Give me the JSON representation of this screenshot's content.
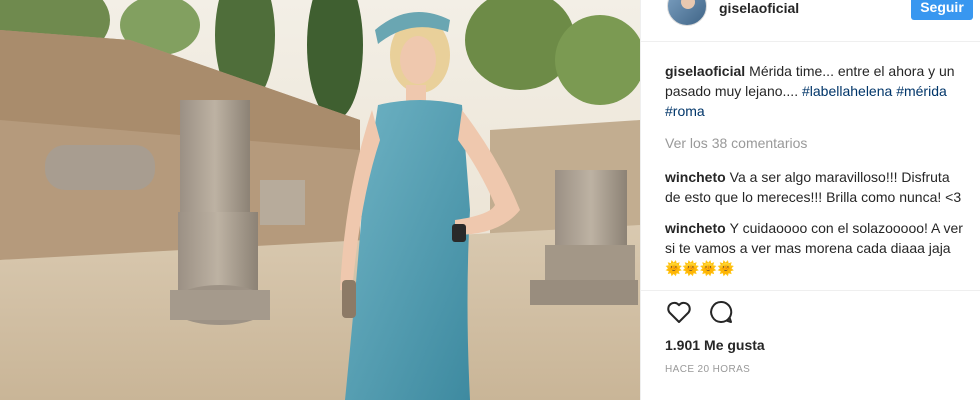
{
  "post": {
    "username": "giselaoficial",
    "follow_label": "Seguir",
    "caption": {
      "user": "giselaoficial",
      "text": "Mérida time... entre el ahora y un pasado muy lejano....",
      "tags": [
        "#labellahelena",
        "#mérida",
        "#roma"
      ]
    },
    "view_all_comments": "Ver los 38 comentarios",
    "comments": [
      {
        "user": "wincheto",
        "text": "Va a ser algo maravilloso!!! Disfruta de esto que lo mereces!!! Brilla como nunca! <3"
      },
      {
        "user": "wincheto",
        "text": "Y cuidaoooo con el solazooooo! A ver si te vamos a ver mas morena cada diaaa jaja 🌞🌞🌞🌞"
      }
    ],
    "likes_count": "1.901",
    "likes_label": "Me gusta",
    "timestamp": "HACE 20 HORAS"
  },
  "icons": {
    "like": "heart-outline-icon",
    "comment": "speech-bubble-icon"
  },
  "colors": {
    "follow_button": "#3897f0",
    "hashtag": "#003569",
    "muted_text": "#999999"
  }
}
